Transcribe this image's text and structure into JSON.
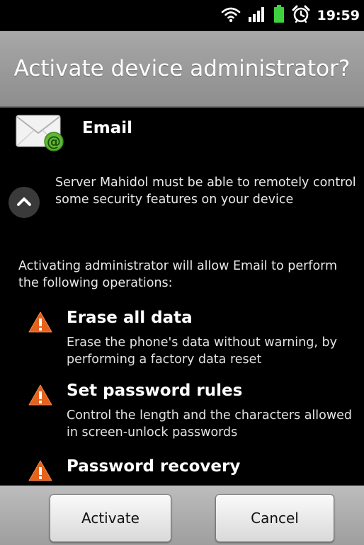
{
  "status_bar": {
    "time": "19:59",
    "icons": [
      "wifi-icon",
      "signal-icon",
      "battery-icon",
      "alarm-icon"
    ],
    "battery_color": "#3ed23e"
  },
  "dialog": {
    "title": "Activate device administrator?",
    "app_name": "Email",
    "app_icon": "email-icon",
    "description": "Server Mahidol must be able to remotely control some security features on your device",
    "collapse_icon": "chevron-up-icon",
    "intro": "Activating administrator will allow Email to perform the following operations:",
    "permissions": [
      {
        "title": "Erase all data",
        "description": "Erase the phone's data without warning, by performing a factory data reset"
      },
      {
        "title": "Set password rules",
        "description": "Control the length and the characters allowed in screen-unlock passwords"
      },
      {
        "title": "Password recovery",
        "description": ""
      }
    ],
    "warning_color": "#e6611a"
  },
  "buttons": {
    "activate": "Activate",
    "cancel": "Cancel"
  }
}
